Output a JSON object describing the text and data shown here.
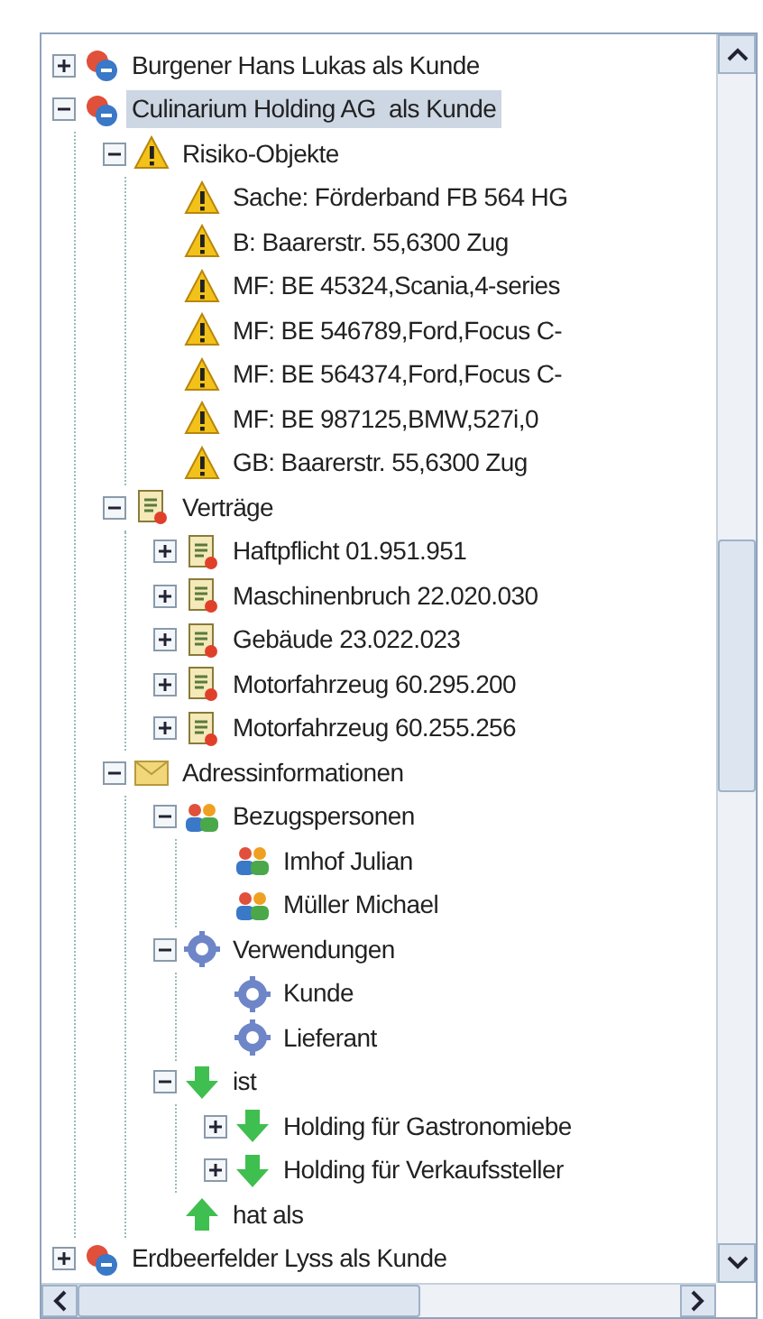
{
  "tree": [
    {
      "label": "Burgener Hans Lukas als Kunde",
      "kind": "customer",
      "expanded": false,
      "selected": false
    },
    {
      "label": "Culinarium Holding AG  als Kunde",
      "kind": "customer",
      "expanded": true,
      "selected": true,
      "children": [
        {
          "label": "Risiko-Objekte",
          "kind": "warning",
          "expanded": true,
          "selected": false,
          "children": [
            {
              "label": "Sache: Förderband FB 564 HG",
              "kind": "warning",
              "selected": false
            },
            {
              "label": "B: Baarerstr. 55,6300 Zug",
              "kind": "warning",
              "selected": false
            },
            {
              "label": "MF: BE 45324,Scania,4-series",
              "kind": "warning",
              "selected": false
            },
            {
              "label": "MF: BE 546789,Ford,Focus C-",
              "kind": "warning",
              "selected": false
            },
            {
              "label": "MF: BE 564374,Ford,Focus C-",
              "kind": "warning",
              "selected": false
            },
            {
              "label": "MF: BE 987125,BMW,527i,0",
              "kind": "warning",
              "selected": false
            },
            {
              "label": "GB: Baarerstr. 55,6300 Zug",
              "kind": "warning",
              "selected": false
            }
          ]
        },
        {
          "label": "Verträge",
          "kind": "contract",
          "expanded": true,
          "selected": false,
          "children": [
            {
              "label": "Haftpflicht 01.951.951",
              "kind": "contract",
              "expanded": false,
              "selected": false
            },
            {
              "label": "Maschinenbruch 22.020.030",
              "kind": "contract",
              "expanded": false,
              "selected": false
            },
            {
              "label": "Gebäude 23.022.023",
              "kind": "contract",
              "expanded": false,
              "selected": false
            },
            {
              "label": "Motorfahrzeug 60.295.200",
              "kind": "contract",
              "expanded": false,
              "selected": false
            },
            {
              "label": "Motorfahrzeug 60.255.256",
              "kind": "contract",
              "expanded": false,
              "selected": false
            }
          ]
        },
        {
          "label": "Adressinformationen",
          "kind": "envelope",
          "expanded": true,
          "selected": false,
          "children": [
            {
              "label": "Bezugspersonen",
              "kind": "people",
              "expanded": true,
              "selected": false,
              "children": [
                {
                  "label": "Imhof Julian",
                  "kind": "people",
                  "selected": false
                },
                {
                  "label": "Müller Michael",
                  "kind": "people",
                  "selected": false
                }
              ]
            },
            {
              "label": "Verwendungen",
              "kind": "gear",
              "expanded": true,
              "selected": false,
              "children": [
                {
                  "label": "Kunde",
                  "kind": "gear",
                  "selected": false
                },
                {
                  "label": "Lieferant",
                  "kind": "gear",
                  "selected": false
                }
              ]
            },
            {
              "label": "ist",
              "kind": "arrow-down",
              "expanded": true,
              "selected": false,
              "children": [
                {
                  "label": "Holding für Gastronomiebe",
                  "kind": "arrow-down",
                  "expanded": false,
                  "selected": false
                },
                {
                  "label": "Holding für Verkaufssteller",
                  "kind": "arrow-down",
                  "expanded": false,
                  "selected": false
                }
              ]
            },
            {
              "label": "hat als",
              "kind": "arrow-up",
              "selected": false
            }
          ]
        }
      ]
    },
    {
      "label": "Erdbeerfelder Lyss als Kunde",
      "kind": "customer",
      "expanded": false,
      "selected": false
    }
  ]
}
